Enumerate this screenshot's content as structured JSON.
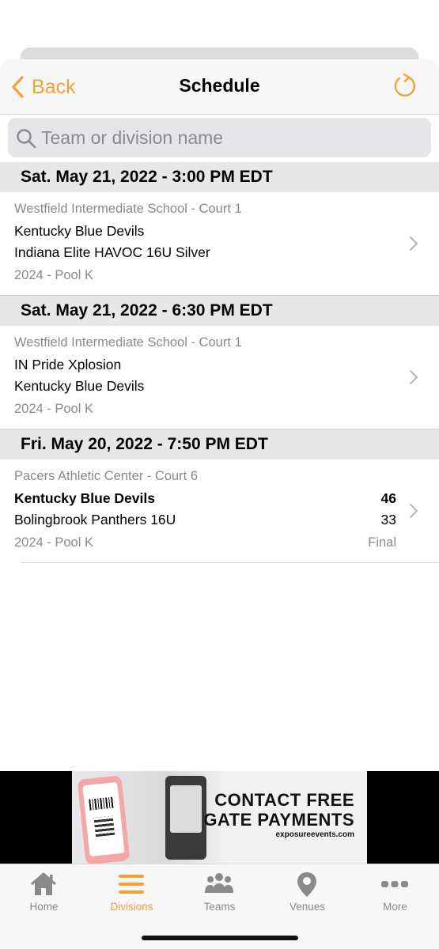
{
  "nav": {
    "back_label": "Back",
    "title": "Schedule"
  },
  "search": {
    "placeholder": "Team or division name"
  },
  "sections": [
    {
      "header": "Sat. May 21, 2022 - 3:00 PM EDT",
      "game": {
        "venue": "Westfield Intermediate School - Court 1",
        "team1": "Kentucky Blue Devils",
        "team2": "Indiana Elite HAVOC 16U Silver",
        "pool": "2024 - Pool K"
      }
    },
    {
      "header": "Sat. May 21, 2022 - 6:30 PM EDT",
      "game": {
        "venue": "Westfield Intermediate School - Court 1",
        "team1": "IN Pride Xplosion",
        "team2": "Kentucky Blue Devils",
        "pool": "2024 - Pool K"
      }
    },
    {
      "header": "Fri. May 20, 2022 - 7:50 PM EDT",
      "game": {
        "venue": "Pacers Athletic Center - Court 6",
        "team1": "Kentucky Blue Devils",
        "team2": "Bolingbrook Panthers 16U",
        "pool": "2024 - Pool K",
        "score1": "46",
        "score2": "33",
        "status": "Final"
      }
    }
  ],
  "ad": {
    "line1": "CONTACT FREE",
    "line2": "GATE PAYMENTS",
    "url": "exposureevents.com"
  },
  "tabs": [
    {
      "label": "Home",
      "icon": "home-icon"
    },
    {
      "label": "Divisions",
      "icon": "list-icon",
      "active": true
    },
    {
      "label": "Teams",
      "icon": "people-icon"
    },
    {
      "label": "Venues",
      "icon": "map-pin-icon"
    },
    {
      "label": "More",
      "icon": "more-icon"
    }
  ],
  "colors": {
    "accent": "#f0a239",
    "inactive": "#8a8a8a"
  }
}
